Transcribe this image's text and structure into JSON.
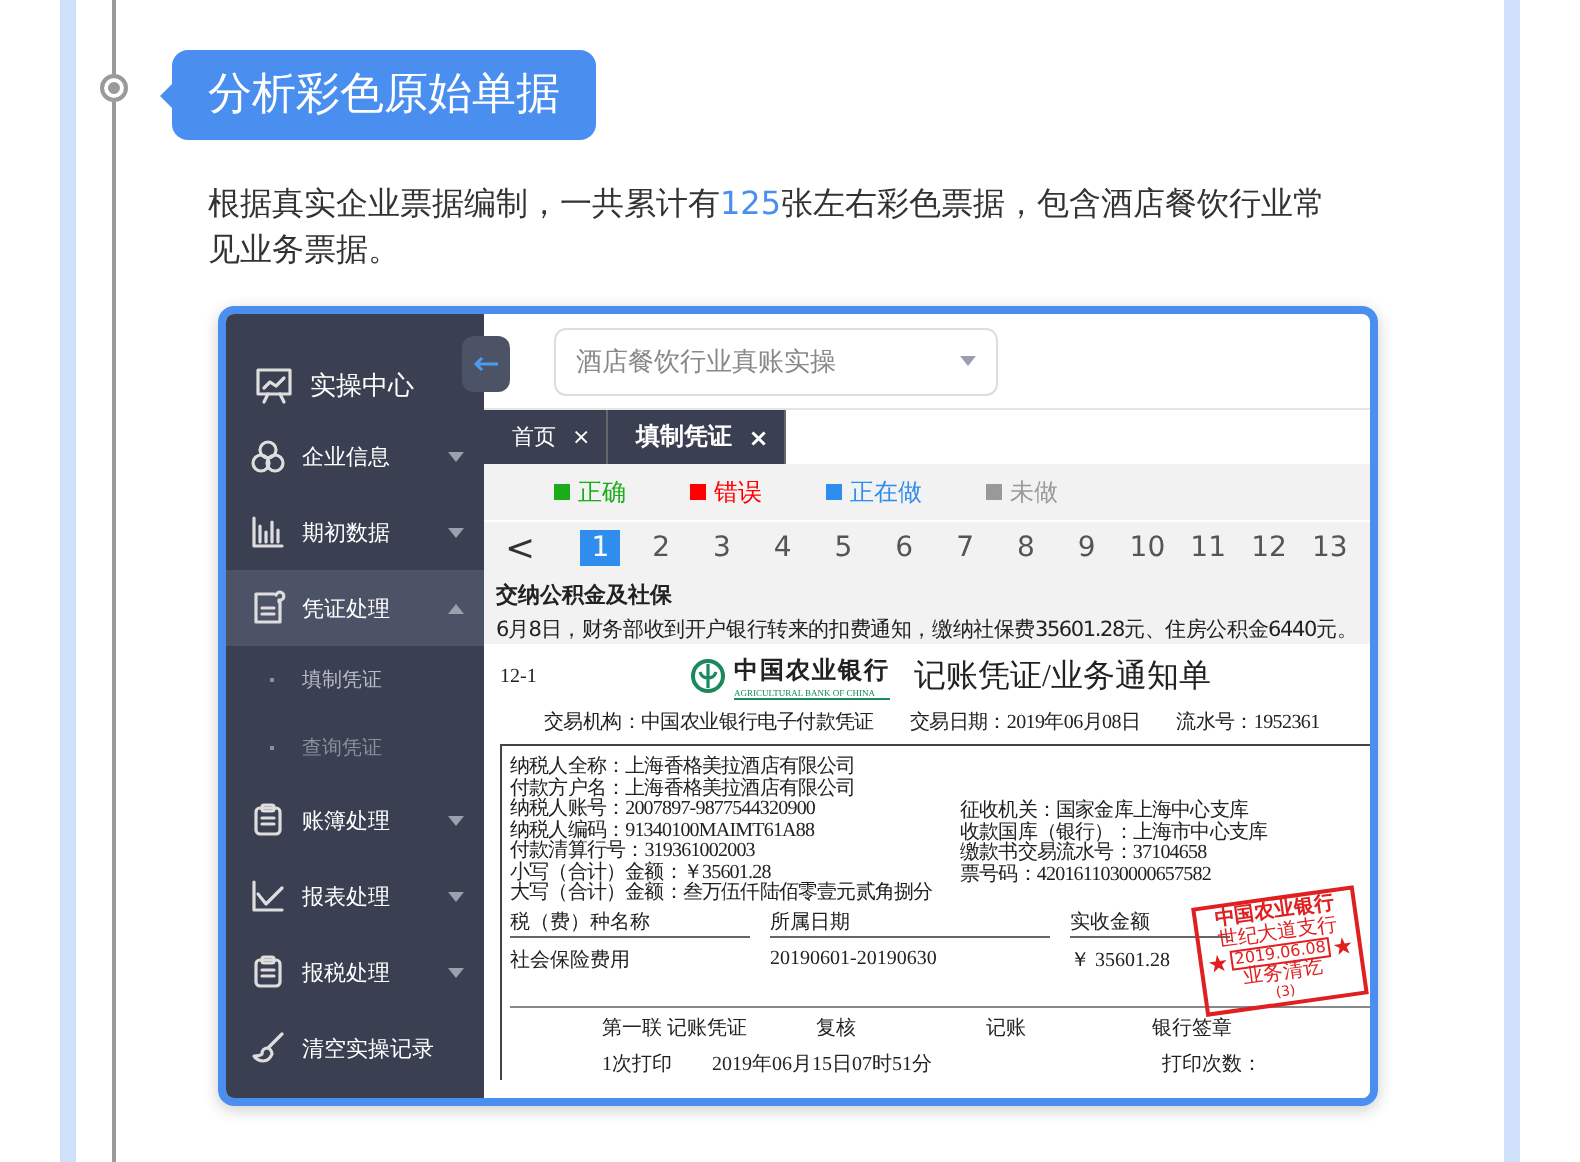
{
  "section": {
    "title": "分析彩色原始单据",
    "description": [
      {
        "text": "根据真实企业票据编制，一共累计有",
        "highlight": false
      },
      {
        "text": "125",
        "highlight": true
      },
      {
        "text": "张左右彩色票据，包含酒店餐饮行业常见业务票据。",
        "highlight": false
      }
    ]
  },
  "app": {
    "sidebar": {
      "title": "实操中心",
      "items": [
        {
          "label": "企业信息",
          "kind": "group",
          "expanded": false,
          "selected": false
        },
        {
          "label": "期初数据",
          "kind": "group",
          "expanded": false,
          "selected": false
        },
        {
          "label": "凭证处理",
          "kind": "group",
          "expanded": true,
          "selected": true,
          "children": [
            {
              "label": "填制凭证",
              "selected": true
            },
            {
              "label": "查询凭证",
              "selected": false
            }
          ]
        },
        {
          "label": "账簿处理",
          "kind": "group",
          "expanded": false,
          "selected": false
        },
        {
          "label": "报表处理",
          "kind": "group",
          "expanded": false,
          "selected": false
        },
        {
          "label": "报税处理",
          "kind": "group",
          "expanded": false,
          "selected": false
        },
        {
          "label": "清空实操记录",
          "kind": "action",
          "selected": false
        }
      ]
    },
    "company_select": {
      "value": "酒店餐饮行业真账实操"
    },
    "tabs": [
      {
        "label": "首页",
        "selected": false,
        "close": "×"
      },
      {
        "label": "填制凭证",
        "selected": true,
        "close": "×"
      }
    ],
    "legend": [
      {
        "label": "正确",
        "color": "#1aad19"
      },
      {
        "label": "错误",
        "color": "#ff0000"
      },
      {
        "label": "正在做",
        "color": "#2e8ded"
      },
      {
        "label": "未做",
        "color": "#999999"
      }
    ],
    "pager": {
      "prev": "<",
      "pages": [
        {
          "label": "1",
          "selected": true
        },
        {
          "label": "2",
          "selected": false
        },
        {
          "label": "3",
          "selected": false
        },
        {
          "label": "4",
          "selected": false
        },
        {
          "label": "5",
          "selected": false
        },
        {
          "label": "6",
          "selected": false
        },
        {
          "label": "7",
          "selected": false
        },
        {
          "label": "8",
          "selected": false
        },
        {
          "label": "9",
          "selected": false
        },
        {
          "label": "10",
          "selected": false
        },
        {
          "label": "11",
          "selected": false
        },
        {
          "label": "12",
          "selected": false
        },
        {
          "label": "13",
          "selected": false
        }
      ]
    },
    "question": {
      "title": "交纳公积金及社保",
      "text": "6月8日，财务部收到开户银行转来的扣费通知，缴纳社保费35601.28元、住房公积金6440元。"
    },
    "document": {
      "number": "12-1",
      "bank_name": "中国农业银行",
      "bank_name_en": "AGRICULTURAL BANK OF CHINA",
      "title": "记账凭证/业务通知单",
      "header_fields": [
        "交易机构：中国农业银行电子付款凭证",
        "交易日期：2019年06月08日",
        "流水号：1952361"
      ],
      "payer_lines": [
        "纳税人全称：上海香格美拉酒店有限公司",
        "付款方户名：上海香格美拉酒店有限公司",
        "纳税人账号：2007897-9877544320900",
        "纳税人编码：91340100MAIMT61A88",
        "付款清算行号：319361002003",
        "小写（合计）金额：￥35601.28",
        "大写（合计）金额：叁万伍仟陆佰零壹元贰角捌分"
      ],
      "collector_lines": [
        "征收机关：国家金库上海中心支库",
        "收款国库（银行）：上海市中心支库",
        "缴款书交易流水号：37104658",
        "票号码：4201611030000657582"
      ],
      "table": {
        "columns": [
          "税（费）种名称",
          "所属日期",
          "实收金额"
        ],
        "row": [
          "社会保险费用",
          "20190601-20190630",
          "￥ 35601.28"
        ]
      },
      "stamp": {
        "bank": "中国农业银行",
        "branch": "世纪大道支行",
        "date": "2019.06.08",
        "status": "业务清讫",
        "number": "(3)"
      },
      "footer": [
        "第一联 记账凭证",
        "复核",
        "记账",
        "银行签章"
      ],
      "print_info": [
        "1次打印",
        "2019年06月15日07时51分",
        "打印次数："
      ]
    }
  }
}
